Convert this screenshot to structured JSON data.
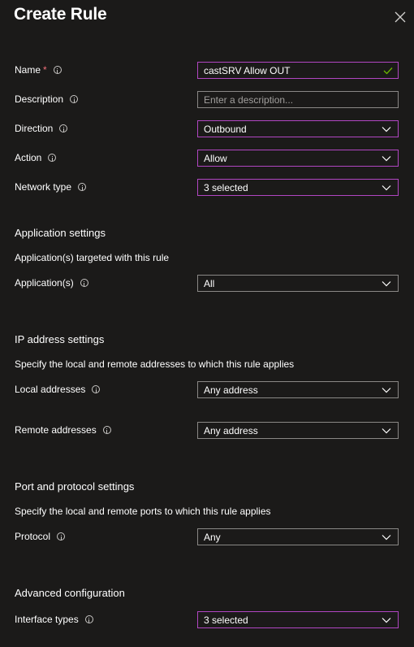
{
  "panel": {
    "title": "Create Rule"
  },
  "fields": {
    "name": {
      "label": "Name",
      "required_mark": "*",
      "value": "castSRV Allow OUT"
    },
    "description": {
      "label": "Description",
      "placeholder": "Enter a description..."
    },
    "direction": {
      "label": "Direction",
      "value": "Outbound"
    },
    "action": {
      "label": "Action",
      "value": "Allow"
    },
    "network_type": {
      "label": "Network type",
      "value": "3 selected"
    }
  },
  "application_settings": {
    "heading": "Application settings",
    "description": "Application(s) targeted with this rule",
    "applications": {
      "label": "Application(s)",
      "value": "All"
    }
  },
  "ip_settings": {
    "heading": "IP address settings",
    "description": "Specify the local and remote addresses to which this rule applies",
    "local_addresses": {
      "label": "Local addresses",
      "value": "Any address"
    },
    "remote_addresses": {
      "label": "Remote addresses",
      "value": "Any address"
    }
  },
  "port_settings": {
    "heading": "Port and protocol settings",
    "description": "Specify the local and remote ports to which this rule applies",
    "protocol": {
      "label": "Protocol",
      "value": "Any"
    }
  },
  "advanced": {
    "heading": "Advanced configuration",
    "interface_types": {
      "label": "Interface types",
      "value": "3 selected"
    }
  },
  "colors": {
    "background": "#1b1a19",
    "focus_border": "#b146c2",
    "default_border": "#8a8886",
    "required": "#f1707b",
    "valid_check": "#6bb700"
  },
  "icons": [
    "close-icon",
    "info-icon",
    "chevron-down-icon",
    "checkmark-icon"
  ]
}
